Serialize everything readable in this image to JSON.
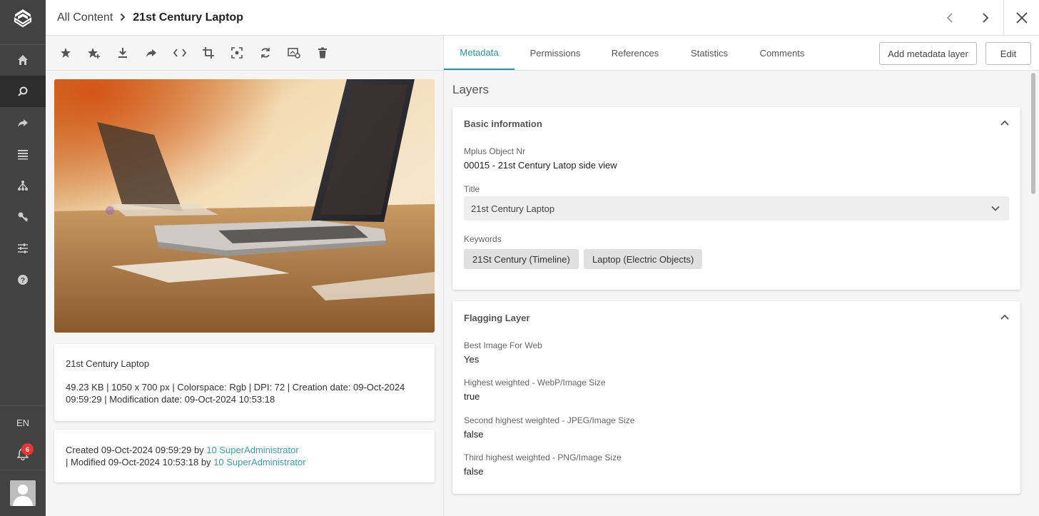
{
  "sidebar": {
    "items": [
      {
        "name": "home-icon"
      },
      {
        "name": "search-icon"
      },
      {
        "name": "share-icon"
      },
      {
        "name": "list-icon"
      },
      {
        "name": "hierarchy-icon"
      },
      {
        "name": "key-icon"
      },
      {
        "name": "sliders-icon"
      },
      {
        "name": "help-icon"
      }
    ],
    "language": "EN",
    "notifications_count": "6"
  },
  "header": {
    "breadcrumb_root": "All Content",
    "title": "21st Century Laptop"
  },
  "toolbar": {
    "icons": [
      "star-icon",
      "star-add-icon",
      "download-icon",
      "share-icon",
      "code-icon",
      "crop-icon",
      "focus-icon",
      "rotate-icon",
      "preview-settings-icon",
      "delete-icon"
    ]
  },
  "file_card": {
    "title": "21st Century Laptop",
    "info": "49.23 KB | 1050 x 700 px | Colorspace: Rgb | DPI: 72 | Creation date: 09-Oct-2024 09:59:29 | Modification date: 09-Oct-2024 10:53:18"
  },
  "history_card": {
    "created_text": "Created 09-Oct-2024 09:59:29 by",
    "created_by": "10 SuperAdministrator",
    "modified_text": "| Modified 09-Oct-2024 10:53:18 by",
    "modified_by": "10 SuperAdministrator"
  },
  "tabs": [
    {
      "label": "Metadata",
      "active": true
    },
    {
      "label": "Permissions"
    },
    {
      "label": "References"
    },
    {
      "label": "Statistics"
    },
    {
      "label": "Comments"
    }
  ],
  "actions": {
    "add_layer": "Add metadata layer",
    "edit": "Edit"
  },
  "layers_title": "Layers",
  "basic_info": {
    "heading": "Basic information",
    "object_nr_label": "Mplus Object Nr",
    "object_nr_value": "00015 - 21st Century Latop side view",
    "title_label": "Title",
    "title_value": "21st Century Laptop",
    "keywords_label": "Keywords",
    "keywords": [
      "21St Century (Timeline)",
      "Laptop (Electric Objects)"
    ]
  },
  "flagging": {
    "heading": "Flagging Layer",
    "fields": [
      {
        "label": "Best Image For Web",
        "value": "Yes"
      },
      {
        "label": "Highest weighted - WebP/Image Size",
        "value": "true"
      },
      {
        "label": "Second highest weighted - JPEG/Image Size",
        "value": "false"
      },
      {
        "label": "Third highest weighted - PNG/Image Size",
        "value": "false"
      }
    ]
  },
  "colors": {
    "accent": "#26919f",
    "link": "#3f9cad",
    "sidebar": "#424242"
  }
}
